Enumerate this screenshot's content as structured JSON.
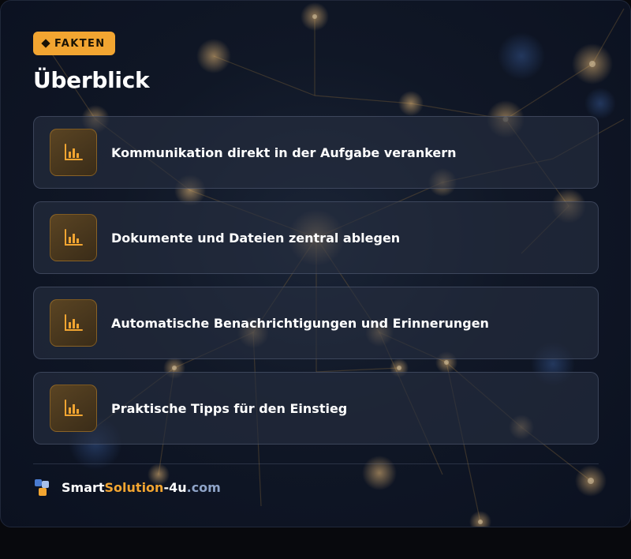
{
  "badge": {
    "icon": "diamond-icon",
    "label": "FAKTEN",
    "color": "#f2a531"
  },
  "title": "Überblick",
  "items": [
    {
      "icon": "bar-chart-icon",
      "label": "Kommunikation direkt in der Aufgabe verankern"
    },
    {
      "icon": "bar-chart-icon",
      "label": "Dokumente und Dateien zentral ablegen"
    },
    {
      "icon": "bar-chart-icon",
      "label": "Automatische Benachrichtigungen und Erinnerungen"
    },
    {
      "icon": "bar-chart-icon",
      "label": "Praktische Tipps für den Einstieg"
    }
  ],
  "footer": {
    "logo_icon": "brand-blocks-icon",
    "brand_smart": "Smart",
    "brand_solution": "Solution",
    "brand_4u": "-4u",
    "brand_com": ".com"
  },
  "colors": {
    "accent": "#f2a531",
    "logo_blue": "#4a7bd0",
    "logo_light": "#a8c0ea",
    "text": "#ffffff",
    "muted": "#8fa4c8"
  }
}
